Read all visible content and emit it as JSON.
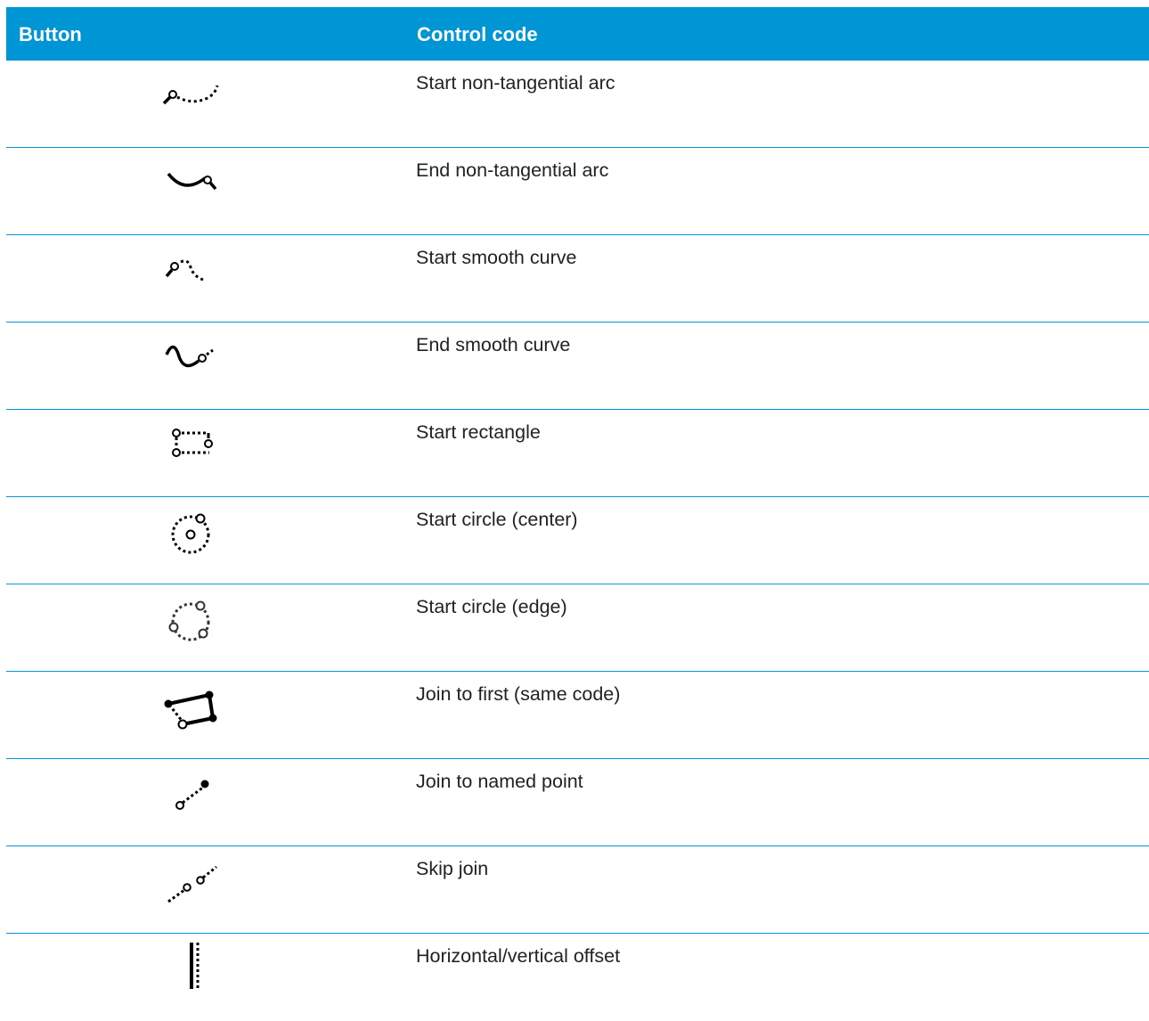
{
  "header": {
    "button": "Button",
    "control_code": "Control code"
  },
  "rows": [
    {
      "icon": "start-non-tangential-arc-icon",
      "label": "Start non-tangential arc"
    },
    {
      "icon": "end-non-tangential-arc-icon",
      "label": "End non-tangential arc"
    },
    {
      "icon": "start-smooth-curve-icon",
      "label": "Start smooth curve"
    },
    {
      "icon": "end-smooth-curve-icon",
      "label": "End smooth curve"
    },
    {
      "icon": "start-rectangle-icon",
      "label": "Start rectangle"
    },
    {
      "icon": "start-circle-center-icon",
      "label": "Start circle (center)"
    },
    {
      "icon": "start-circle-edge-icon",
      "label": "Start circle (edge)"
    },
    {
      "icon": "join-to-first-icon",
      "label": "Join to first (same code)"
    },
    {
      "icon": "join-to-named-point-icon",
      "label": "Join to named point"
    },
    {
      "icon": "skip-join-icon",
      "label": "Skip join"
    },
    {
      "icon": "horizontal-vertical-offset-icon",
      "label": "Horizontal/vertical offset"
    }
  ],
  "colors": {
    "header_bg": "#0096d6",
    "divider": "#0096d6"
  }
}
